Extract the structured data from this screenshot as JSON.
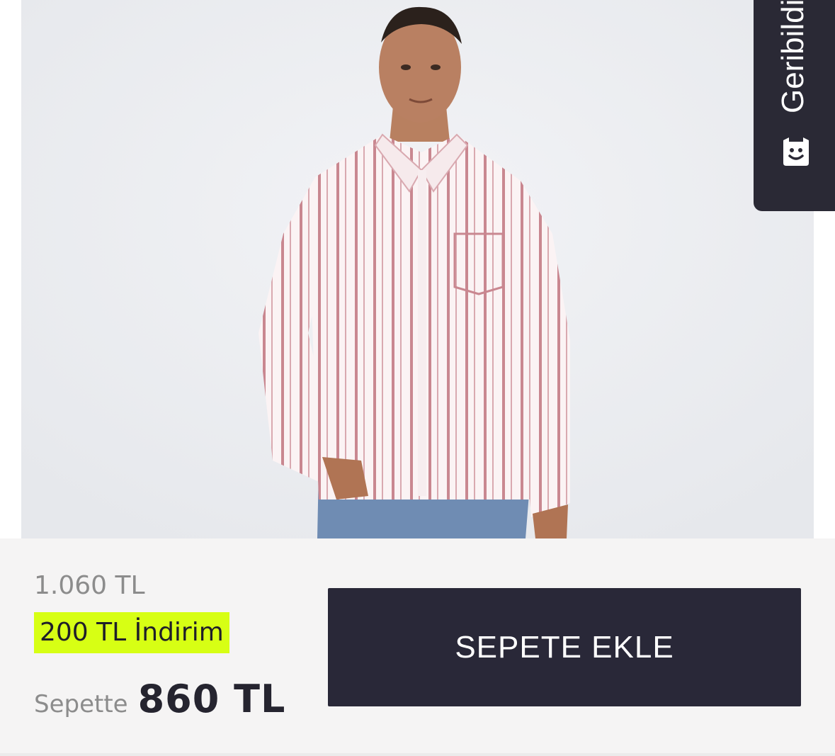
{
  "product": {
    "image_alt": "Pembe çizgili gömlek giyen model"
  },
  "feedback": {
    "label": "Geribildirim",
    "icon": "smiley-face-icon"
  },
  "pricing": {
    "old_price": "1.060 TL",
    "discount": "200 TL İndirim",
    "basket_label": "Sepette",
    "basket_price": "860 TL"
  },
  "actions": {
    "add_to_cart": "SEPETE EKLE"
  },
  "colors": {
    "dark": "#292838",
    "discount_highlight": "#d7ff14",
    "muted_text": "#8c8c8c"
  }
}
